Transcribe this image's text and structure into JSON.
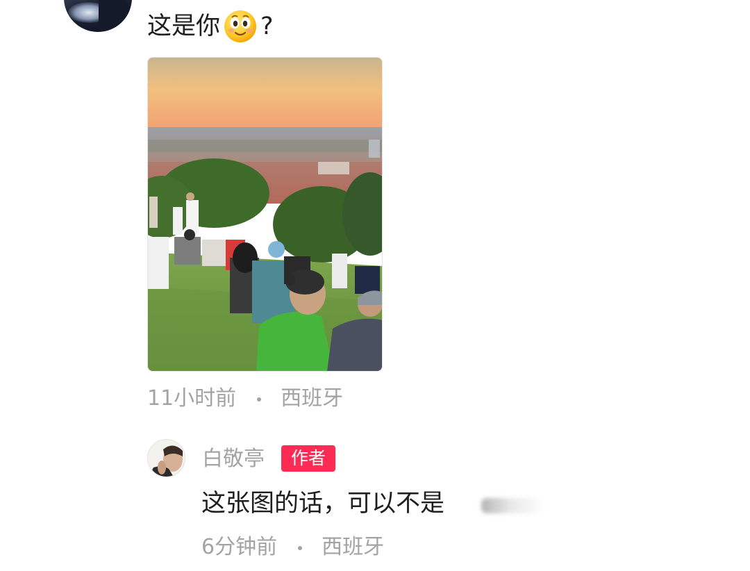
{
  "top_comment": {
    "text": "这是你",
    "emoji": "smiling-face-emoji",
    "suffix": "?",
    "meta": {
      "time": "11小时前",
      "location": "西班牙"
    }
  },
  "photo": {
    "description_icon": "photo-thumbnail",
    "colors": {
      "sky_top": "#c9b48f",
      "sky_bottom": "#f2a272",
      "grass": "#6f9a44"
    }
  },
  "reply": {
    "username": "白敬亭",
    "badge": "作者",
    "text": "这张图的话，可以不是",
    "meta": {
      "time": "6分钟前",
      "location": "西班牙"
    },
    "colors": {
      "badge_bg": "#fe2c55"
    }
  }
}
